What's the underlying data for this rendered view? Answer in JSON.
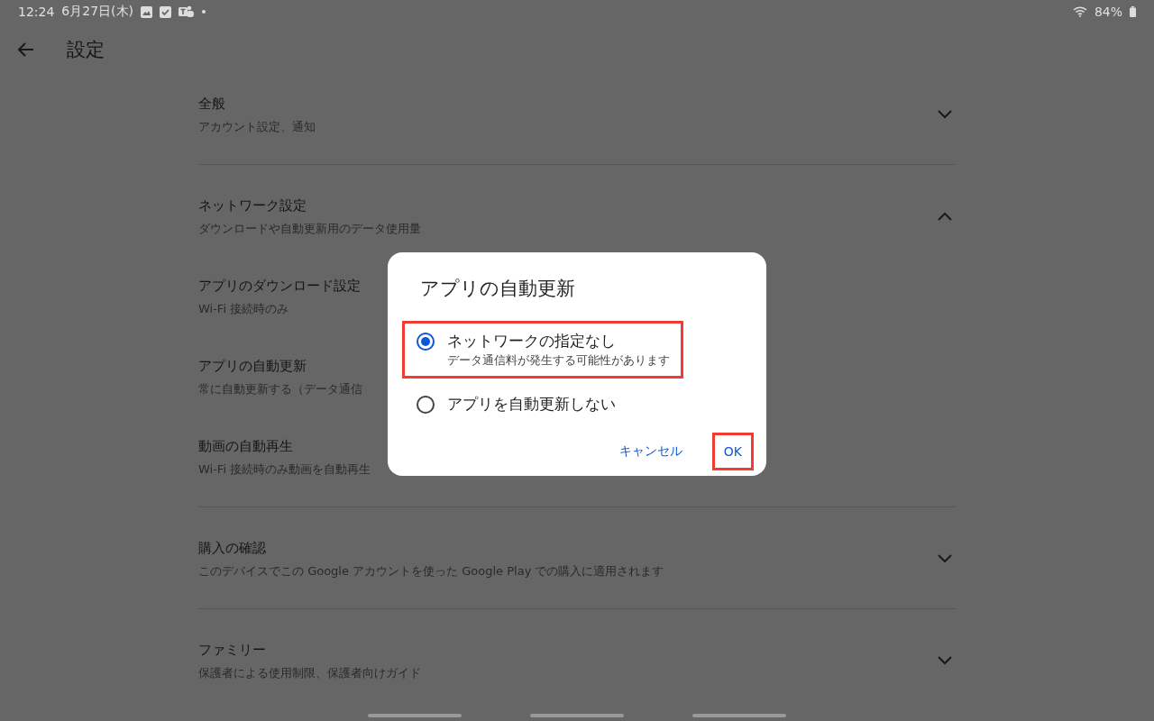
{
  "status_bar": {
    "time": "12:24",
    "date": "6月27日(木)",
    "battery": "84%"
  },
  "header": {
    "title": "設定"
  },
  "sections": [
    {
      "title": "全般",
      "subtitle": "アカウント設定、通知",
      "expanded": false
    },
    {
      "title": "ネットワーク設定",
      "subtitle": "ダウンロードや自動更新用のデータ使用量",
      "expanded": true,
      "items": [
        {
          "title": "アプリのダウンロード設定",
          "subtitle": "Wi-Fi 接続時のみ"
        },
        {
          "title": "アプリの自動更新",
          "subtitle": "常に自動更新する（データ通信"
        },
        {
          "title": "動画の自動再生",
          "subtitle": "Wi-Fi 接続時のみ動画を自動再生"
        }
      ]
    },
    {
      "title": "購入の確認",
      "subtitle": "このデバイスでこの Google アカウントを使った Google Play での購入に適用されます",
      "expanded": false
    },
    {
      "title": "ファミリー",
      "subtitle": "保護者による使用制限、保護者向けガイド",
      "expanded": false
    }
  ],
  "dialog": {
    "title": "アプリの自動更新",
    "options": [
      {
        "label": "ネットワークの指定なし",
        "description": "データ通信料が発生する可能性があります",
        "selected": true,
        "highlighted": true
      },
      {
        "label": "アプリを自動更新しない",
        "selected": false,
        "highlighted": false
      }
    ],
    "buttons": [
      {
        "label": "キャンセル",
        "highlighted": false
      },
      {
        "label": "OK",
        "highlighted": true
      }
    ]
  }
}
